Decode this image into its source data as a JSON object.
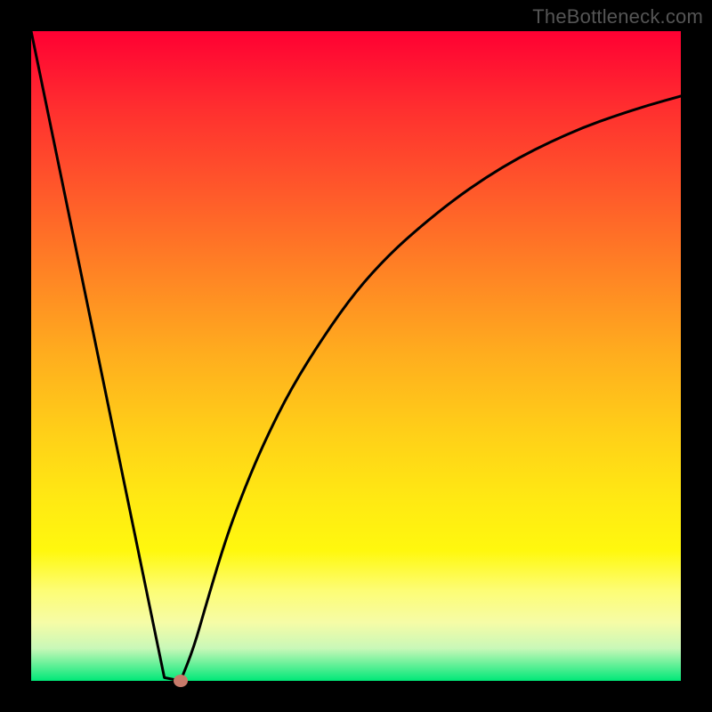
{
  "watermark": "TheBottleneck.com",
  "chart_data": {
    "type": "line",
    "title": "",
    "xlabel": "",
    "ylabel": "",
    "xlim": [
      0,
      100
    ],
    "ylim": [
      0,
      100
    ],
    "left_line": {
      "x": [
        0,
        20.5,
        23
      ],
      "y": [
        100,
        0.5,
        0
      ]
    },
    "right_curve": {
      "x": [
        23,
        25,
        27,
        30,
        33,
        36,
        40,
        45,
        50,
        55,
        60,
        65,
        70,
        75,
        80,
        85,
        90,
        95,
        100
      ],
      "y": [
        0,
        5,
        12,
        22,
        30,
        37,
        45,
        53,
        60,
        65.5,
        70,
        74,
        77.5,
        80.5,
        83,
        85.2,
        87,
        88.6,
        90
      ]
    },
    "marker": {
      "x": 23,
      "y": 0
    },
    "colors": {
      "line": "#000000",
      "marker": "#c77a6a",
      "gradient_top": "#ff0033",
      "gradient_bottom": "#00e878"
    }
  }
}
